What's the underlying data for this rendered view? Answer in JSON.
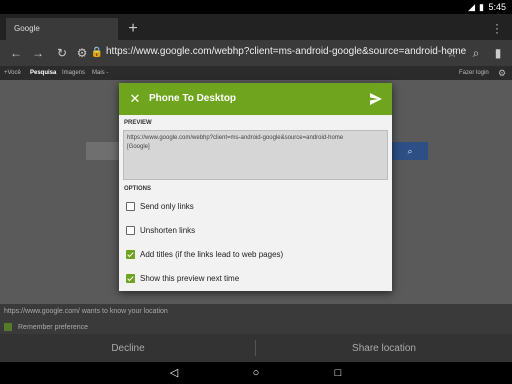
{
  "status_bar": {
    "time": "5:45"
  },
  "browser": {
    "tab_title": "Google",
    "url": "https://www.google.com/webhp?client=ms-android-google&source=android-home"
  },
  "google_bar": {
    "items": [
      "+Você",
      "Pesquisa",
      "Imagens",
      "Mais -"
    ],
    "login": "Fazer login"
  },
  "location_prompt": {
    "message": "https://www.google.com/ wants to know your location",
    "remember": "Remember preference",
    "decline": "Decline",
    "share": "Share location"
  },
  "dialog": {
    "title": "Phone To Desktop",
    "preview_label": "PREVIEW",
    "preview_text": "https://www.google.com/webhp?client=ms-android-google&source=android-home\n[Google]",
    "options_label": "OPTIONS",
    "options": [
      {
        "label": "Send only links",
        "checked": false
      },
      {
        "label": "Unshorten links",
        "checked": false
      },
      {
        "label": "Add titles (if the links lead to web pages)",
        "checked": true
      },
      {
        "label": "Show this preview next time",
        "checked": true
      }
    ]
  },
  "colors": {
    "accent": "#6fa51e",
    "search_button": "#2d4f86"
  },
  "icons": [
    "signal-icon",
    "battery-icon",
    "back-icon",
    "forward-icon",
    "reload-icon",
    "lock-icon",
    "star-icon",
    "search-icon",
    "bookmark-icon",
    "settings-icon",
    "close-icon",
    "send-icon",
    "nav-back-icon",
    "nav-home-icon",
    "nav-recents-icon"
  ]
}
